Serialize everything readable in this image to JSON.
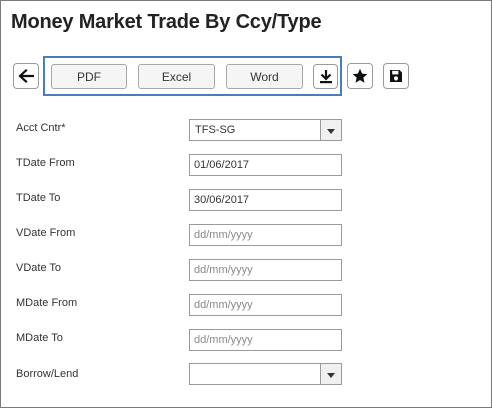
{
  "page": {
    "title": "Money Market Trade By Ccy/Type"
  },
  "toolbar": {
    "back_icon": "arrow-left-icon",
    "export_buttons": {
      "pdf": "PDF",
      "excel": "Excel",
      "word": "Word"
    },
    "download_icon": "download-icon",
    "favorite_icon": "star-icon",
    "save_icon": "floppy-disk-icon",
    "accent_color": "#4a7cc0"
  },
  "form": {
    "acct_cntr": {
      "label": "Acct Cntr*",
      "value": "TFS-SG"
    },
    "tdate_from": {
      "label": "TDate From",
      "value": "01/06/2017",
      "placeholder": "dd/mm/yyyy"
    },
    "tdate_to": {
      "label": "TDate To",
      "value": "30/06/2017",
      "placeholder": "dd/mm/yyyy"
    },
    "vdate_from": {
      "label": "VDate From",
      "value": "",
      "placeholder": "dd/mm/yyyy"
    },
    "vdate_to": {
      "label": "VDate To",
      "value": "",
      "placeholder": "dd/mm/yyyy"
    },
    "mdate_from": {
      "label": "MDate From",
      "value": "",
      "placeholder": "dd/mm/yyyy"
    },
    "mdate_to": {
      "label": "MDate To",
      "value": "",
      "placeholder": "dd/mm/yyyy"
    },
    "borrow_lend": {
      "label": "Borrow/Lend",
      "value": ""
    }
  }
}
